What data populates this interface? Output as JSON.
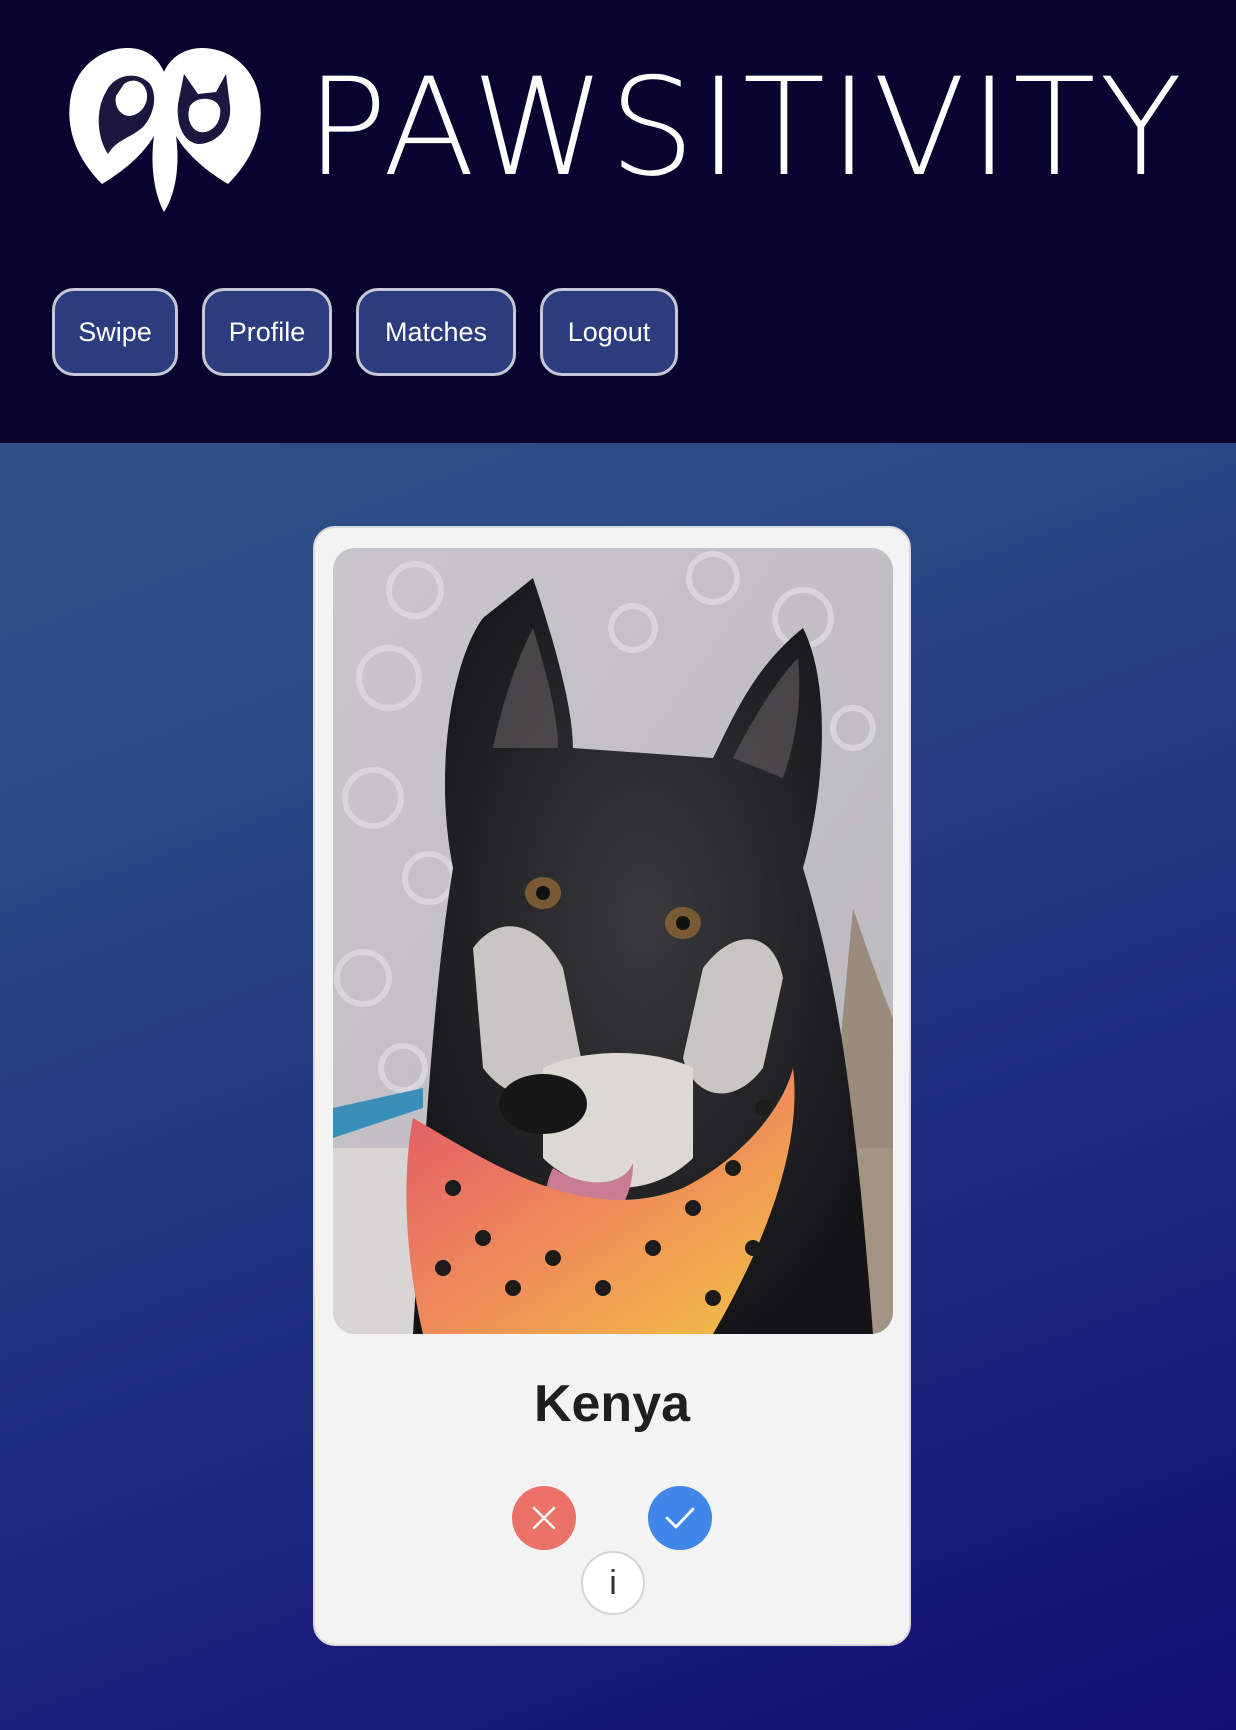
{
  "app": {
    "name": "PAWSITIVITY"
  },
  "nav": {
    "items": [
      {
        "label": "Swipe"
      },
      {
        "label": "Profile"
      },
      {
        "label": "Matches"
      },
      {
        "label": "Logout"
      }
    ]
  },
  "card": {
    "pet_name": "Kenya",
    "photo_icon": "dog-photo",
    "actions": {
      "reject_icon": "close-icon",
      "like_icon": "check-icon",
      "info_label": "i"
    }
  },
  "colors": {
    "header_bg": "#07042f",
    "nav_button_bg": "#2c3c7e",
    "reject": "#ec7168",
    "like": "#3f86e8",
    "card_bg": "#f3f3f3"
  }
}
